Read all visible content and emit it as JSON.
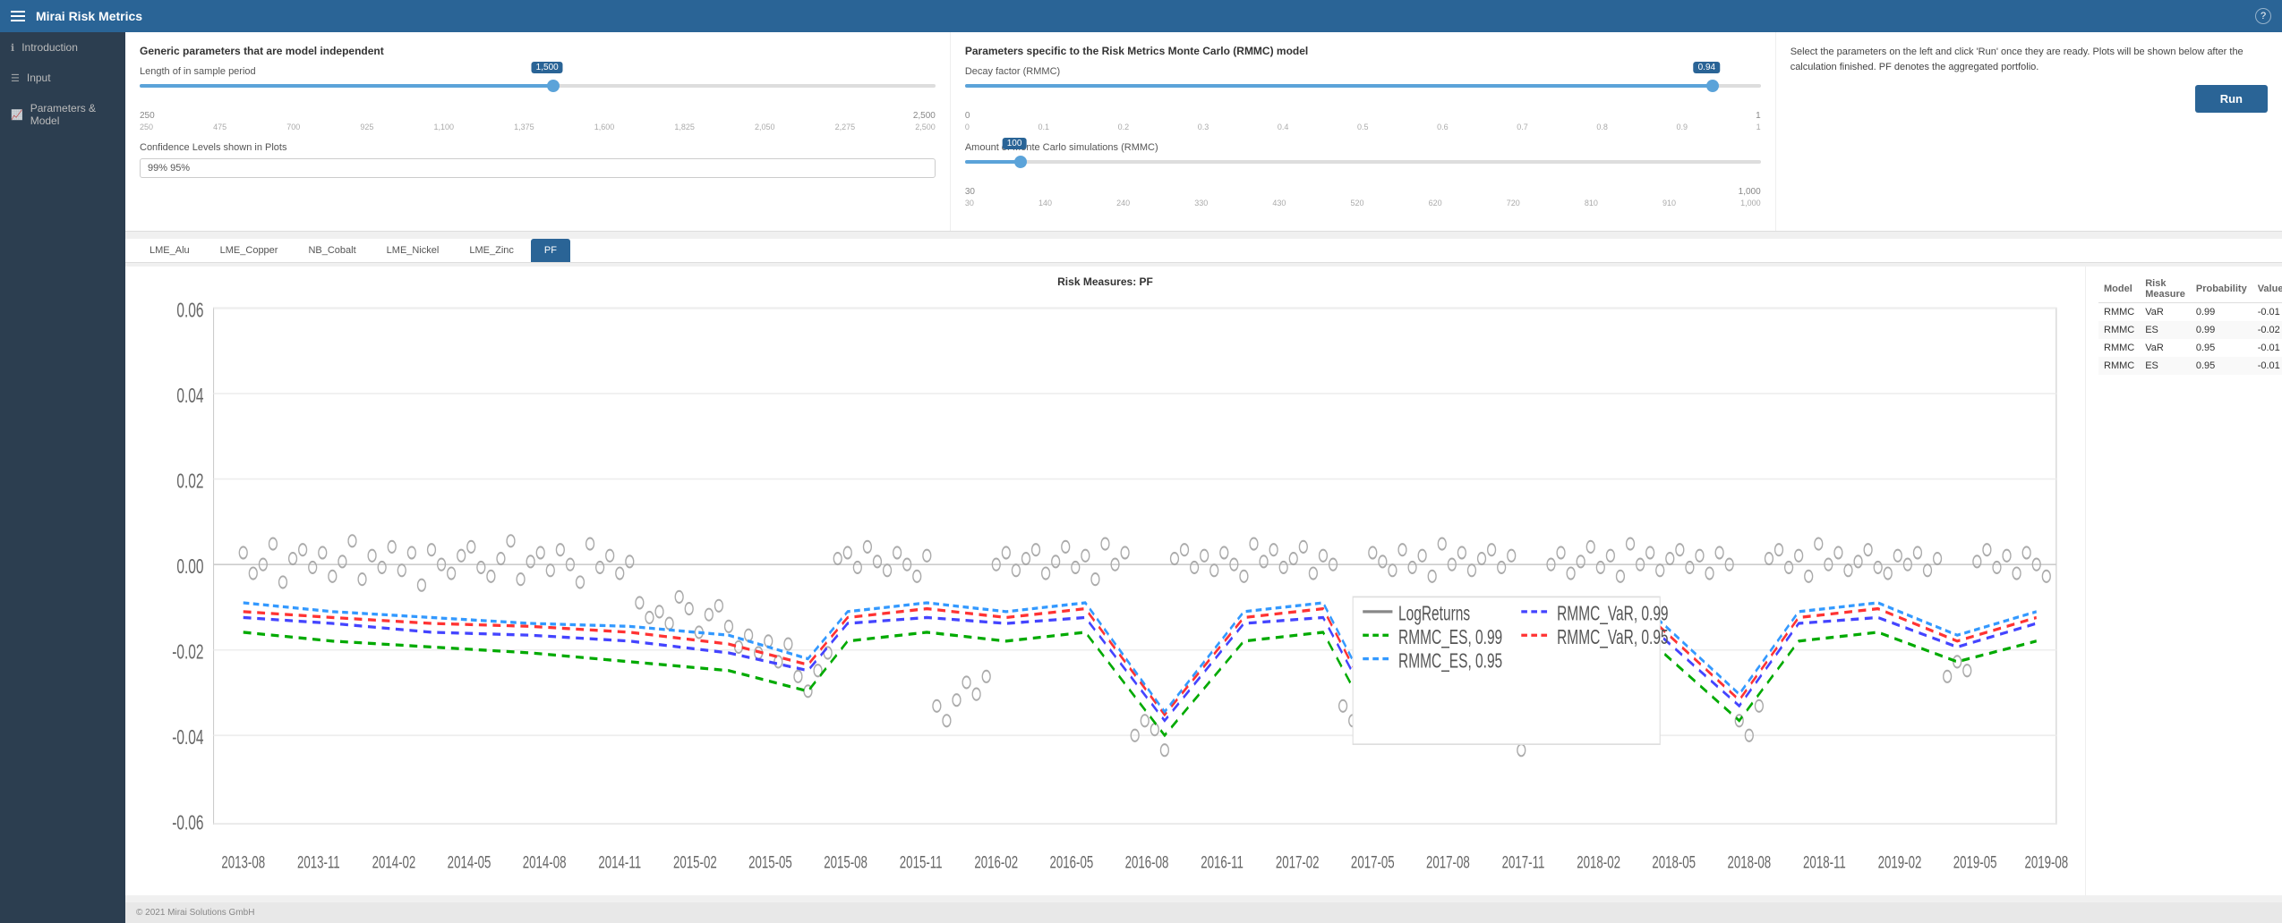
{
  "app": {
    "title": "Mirai Risk Metrics",
    "footer": "© 2021 Mirai Solutions GmbH"
  },
  "navbar": {
    "help_label": "?"
  },
  "sidebar": {
    "items": [
      {
        "id": "introduction",
        "label": "Introduction",
        "icon": "ℹ"
      },
      {
        "id": "input",
        "label": "Input",
        "icon": "☰"
      },
      {
        "id": "parameters-model",
        "label": "Parameters & Model",
        "icon": "📊"
      }
    ]
  },
  "params": {
    "panel1_title": "Generic parameters that are model independent",
    "in_sample_label": "Length of in sample period",
    "in_sample_min": "250",
    "in_sample_max": "2,500",
    "in_sample_value": "1,500",
    "in_sample_pct": 52,
    "in_sample_ticks": [
      "250",
      "475",
      "700",
      "925",
      "1,100",
      "1,375",
      "1,600",
      "1,825",
      "2,050",
      "2,275",
      "2,500"
    ],
    "conf_label": "Confidence Levels shown in Plots",
    "conf_value": "99% 95%",
    "panel2_title": "Parameters specific to the Risk Metrics Monte Carlo (RMMC) model",
    "decay_label": "Decay factor (RMMC)",
    "decay_min": "0",
    "decay_max": "1",
    "decay_value": "0.94",
    "decay_pct": 94,
    "decay_ticks": [
      "0",
      "0.1",
      "0.2",
      "0.3",
      "0.4",
      "0.5",
      "0.6",
      "0.7",
      "0.8",
      "0.9",
      "1"
    ],
    "mc_label": "Amount of Monte Carlo simulations (RMMC)",
    "mc_min": "30",
    "mc_max": "1,000",
    "mc_value": "100",
    "mc_pct": 7,
    "mc_ticks": [
      "30",
      "140",
      "240",
      "330",
      "430",
      "520",
      "620",
      "720",
      "810",
      "910",
      "1,000"
    ],
    "panel3_description": "Select the parameters on the left and click 'Run' once they are ready. Plots will be shown below after the calculation finished. PF denotes the aggregated portfolio.",
    "run_label": "Run"
  },
  "tabs": [
    {
      "id": "lme-alu",
      "label": "LME_Alu"
    },
    {
      "id": "lme-copper",
      "label": "LME_Copper"
    },
    {
      "id": "nb-cobalt",
      "label": "NB_Cobalt"
    },
    {
      "id": "lme-nickel",
      "label": "LME_Nickel"
    },
    {
      "id": "lme-zinc",
      "label": "LME_Zinc"
    },
    {
      "id": "pf",
      "label": "PF",
      "active": true
    }
  ],
  "chart": {
    "title": "Risk Measures: PF",
    "legend": [
      {
        "label": "LogReturns",
        "color": "#888",
        "style": "scatter"
      },
      {
        "label": "RMMC_ES, 0.99",
        "color": "#00aa00",
        "style": "dashed"
      },
      {
        "label": "RMMC_ES, 0.95",
        "color": "#0000ff",
        "style": "dashed"
      },
      {
        "label": "RMMC_VaR, 0.95",
        "color": "#ff0000",
        "style": "dashed"
      },
      {
        "label": "RMMC_VaR, 0.99",
        "color": "#0066ff",
        "style": "dashed"
      }
    ],
    "x_labels": [
      "2013-08",
      "2013-11",
      "2014-02",
      "2014-05",
      "2014-08",
      "2014-11",
      "2015-02",
      "2015-05",
      "2015-08",
      "2015-11",
      "2016-02",
      "2016-05",
      "2016-08",
      "2016-11",
      "2017-02",
      "2017-05",
      "2017-08",
      "2017-11",
      "2018-02",
      "2018-05",
      "2018-08",
      "2018-11",
      "2019-02",
      "2019-05",
      "2019-08"
    ],
    "y_min": -0.06,
    "y_max": 0.06
  },
  "stats": {
    "columns": [
      "Model",
      "Risk Measure",
      "Probability",
      "Value"
    ],
    "rows": [
      {
        "model": "RMMC",
        "measure": "VaR",
        "probability": "0.99",
        "value": "-0.01"
      },
      {
        "model": "RMMC",
        "measure": "ES",
        "probability": "0.99",
        "value": "-0.02"
      },
      {
        "model": "RMMC",
        "measure": "VaR",
        "probability": "0.95",
        "value": "-0.01"
      },
      {
        "model": "RMMC",
        "measure": "ES",
        "probability": "0.95",
        "value": "-0.01"
      }
    ]
  }
}
